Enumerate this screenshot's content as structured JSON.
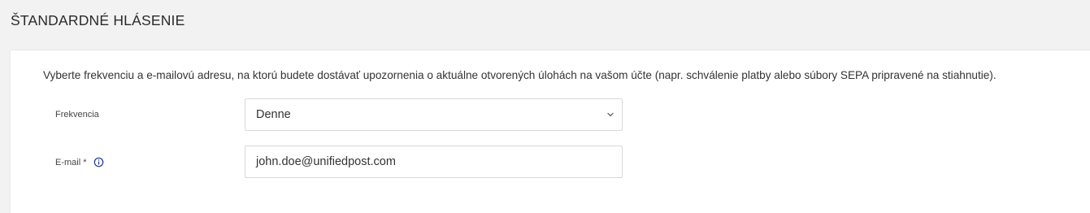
{
  "section": {
    "title": "ŠTANDARDNÉ HLÁSENIE"
  },
  "card": {
    "description": "Vyberte frekvenciu a e-mailovú adresu, na ktorú budete dostávať upozornenia o aktuálne otvorených úlohách na vašom účte (napr. schválenie platby alebo súbory SEPA pripravené na stiahnutie)."
  },
  "form": {
    "frequency": {
      "label": "Frekvencia",
      "value": "Denne",
      "icon": "chevron-down-icon"
    },
    "email": {
      "label": "E-mail *",
      "value": "john.doe@unifiedpost.com",
      "icon": "info-icon"
    }
  },
  "colors": {
    "page_background": "#f2f2f2",
    "card_background": "#ffffff",
    "border": "#d9d9d9",
    "text": "#333333"
  }
}
